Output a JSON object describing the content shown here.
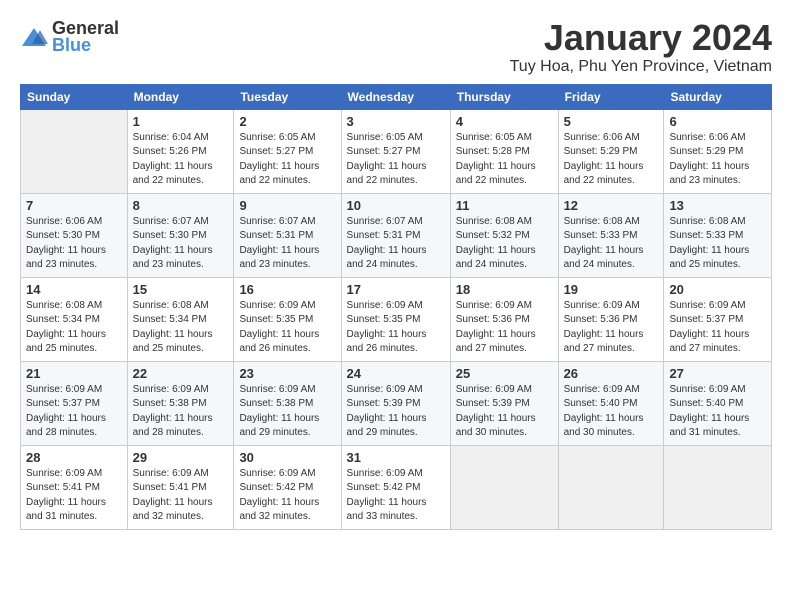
{
  "header": {
    "logo_general": "General",
    "logo_blue": "Blue",
    "title": "January 2024",
    "subtitle": "Tuy Hoa, Phu Yen Province, Vietnam"
  },
  "days_of_week": [
    "Sunday",
    "Monday",
    "Tuesday",
    "Wednesday",
    "Thursday",
    "Friday",
    "Saturday"
  ],
  "weeks": [
    [
      {
        "day": "",
        "info": ""
      },
      {
        "day": "1",
        "info": "Sunrise: 6:04 AM\nSunset: 5:26 PM\nDaylight: 11 hours\nand 22 minutes."
      },
      {
        "day": "2",
        "info": "Sunrise: 6:05 AM\nSunset: 5:27 PM\nDaylight: 11 hours\nand 22 minutes."
      },
      {
        "day": "3",
        "info": "Sunrise: 6:05 AM\nSunset: 5:27 PM\nDaylight: 11 hours\nand 22 minutes."
      },
      {
        "day": "4",
        "info": "Sunrise: 6:05 AM\nSunset: 5:28 PM\nDaylight: 11 hours\nand 22 minutes."
      },
      {
        "day": "5",
        "info": "Sunrise: 6:06 AM\nSunset: 5:29 PM\nDaylight: 11 hours\nand 22 minutes."
      },
      {
        "day": "6",
        "info": "Sunrise: 6:06 AM\nSunset: 5:29 PM\nDaylight: 11 hours\nand 23 minutes."
      }
    ],
    [
      {
        "day": "7",
        "info": "Sunrise: 6:06 AM\nSunset: 5:30 PM\nDaylight: 11 hours\nand 23 minutes."
      },
      {
        "day": "8",
        "info": "Sunrise: 6:07 AM\nSunset: 5:30 PM\nDaylight: 11 hours\nand 23 minutes."
      },
      {
        "day": "9",
        "info": "Sunrise: 6:07 AM\nSunset: 5:31 PM\nDaylight: 11 hours\nand 23 minutes."
      },
      {
        "day": "10",
        "info": "Sunrise: 6:07 AM\nSunset: 5:31 PM\nDaylight: 11 hours\nand 24 minutes."
      },
      {
        "day": "11",
        "info": "Sunrise: 6:08 AM\nSunset: 5:32 PM\nDaylight: 11 hours\nand 24 minutes."
      },
      {
        "day": "12",
        "info": "Sunrise: 6:08 AM\nSunset: 5:33 PM\nDaylight: 11 hours\nand 24 minutes."
      },
      {
        "day": "13",
        "info": "Sunrise: 6:08 AM\nSunset: 5:33 PM\nDaylight: 11 hours\nand 25 minutes."
      }
    ],
    [
      {
        "day": "14",
        "info": "Sunrise: 6:08 AM\nSunset: 5:34 PM\nDaylight: 11 hours\nand 25 minutes."
      },
      {
        "day": "15",
        "info": "Sunrise: 6:08 AM\nSunset: 5:34 PM\nDaylight: 11 hours\nand 25 minutes."
      },
      {
        "day": "16",
        "info": "Sunrise: 6:09 AM\nSunset: 5:35 PM\nDaylight: 11 hours\nand 26 minutes."
      },
      {
        "day": "17",
        "info": "Sunrise: 6:09 AM\nSunset: 5:35 PM\nDaylight: 11 hours\nand 26 minutes."
      },
      {
        "day": "18",
        "info": "Sunrise: 6:09 AM\nSunset: 5:36 PM\nDaylight: 11 hours\nand 27 minutes."
      },
      {
        "day": "19",
        "info": "Sunrise: 6:09 AM\nSunset: 5:36 PM\nDaylight: 11 hours\nand 27 minutes."
      },
      {
        "day": "20",
        "info": "Sunrise: 6:09 AM\nSunset: 5:37 PM\nDaylight: 11 hours\nand 27 minutes."
      }
    ],
    [
      {
        "day": "21",
        "info": "Sunrise: 6:09 AM\nSunset: 5:37 PM\nDaylight: 11 hours\nand 28 minutes."
      },
      {
        "day": "22",
        "info": "Sunrise: 6:09 AM\nSunset: 5:38 PM\nDaylight: 11 hours\nand 28 minutes."
      },
      {
        "day": "23",
        "info": "Sunrise: 6:09 AM\nSunset: 5:38 PM\nDaylight: 11 hours\nand 29 minutes."
      },
      {
        "day": "24",
        "info": "Sunrise: 6:09 AM\nSunset: 5:39 PM\nDaylight: 11 hours\nand 29 minutes."
      },
      {
        "day": "25",
        "info": "Sunrise: 6:09 AM\nSunset: 5:39 PM\nDaylight: 11 hours\nand 30 minutes."
      },
      {
        "day": "26",
        "info": "Sunrise: 6:09 AM\nSunset: 5:40 PM\nDaylight: 11 hours\nand 30 minutes."
      },
      {
        "day": "27",
        "info": "Sunrise: 6:09 AM\nSunset: 5:40 PM\nDaylight: 11 hours\nand 31 minutes."
      }
    ],
    [
      {
        "day": "28",
        "info": "Sunrise: 6:09 AM\nSunset: 5:41 PM\nDaylight: 11 hours\nand 31 minutes."
      },
      {
        "day": "29",
        "info": "Sunrise: 6:09 AM\nSunset: 5:41 PM\nDaylight: 11 hours\nand 32 minutes."
      },
      {
        "day": "30",
        "info": "Sunrise: 6:09 AM\nSunset: 5:42 PM\nDaylight: 11 hours\nand 32 minutes."
      },
      {
        "day": "31",
        "info": "Sunrise: 6:09 AM\nSunset: 5:42 PM\nDaylight: 11 hours\nand 33 minutes."
      },
      {
        "day": "",
        "info": ""
      },
      {
        "day": "",
        "info": ""
      },
      {
        "day": "",
        "info": ""
      }
    ]
  ]
}
